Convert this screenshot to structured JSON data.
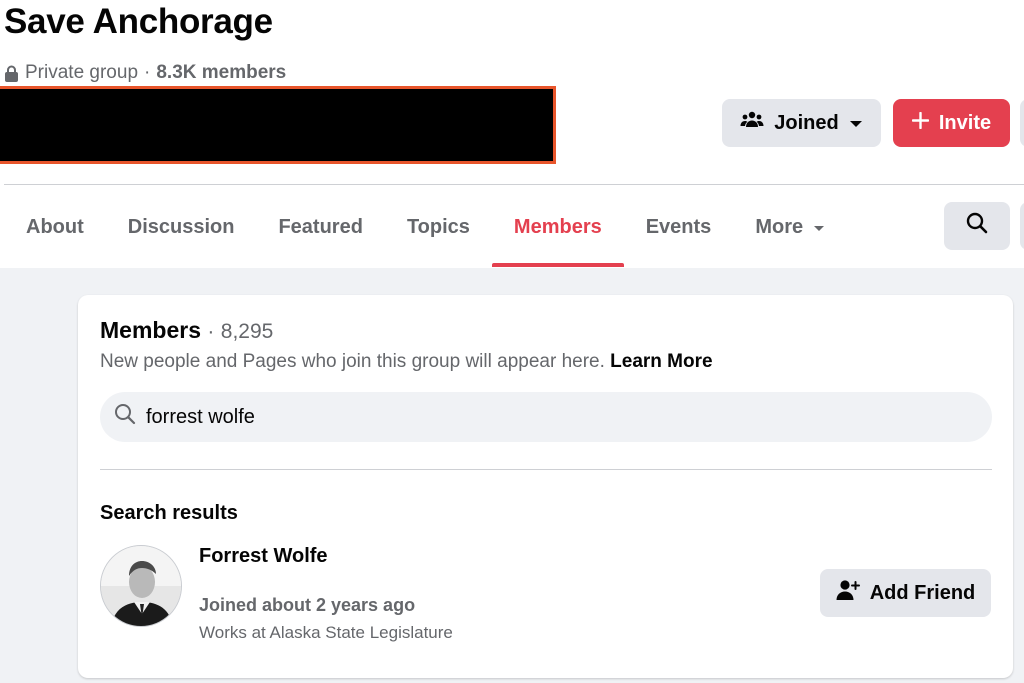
{
  "group": {
    "title": "Save Anchorage",
    "privacy": "Private group",
    "separator": "·",
    "members_short": "8.3K members"
  },
  "actions": {
    "joined_label": "Joined",
    "invite_label": "Invite"
  },
  "tabs": [
    {
      "label": "About"
    },
    {
      "label": "Discussion"
    },
    {
      "label": "Featured"
    },
    {
      "label": "Topics"
    },
    {
      "label": "Members"
    },
    {
      "label": "Events"
    },
    {
      "label": "More"
    }
  ],
  "members_card": {
    "title": "Members",
    "separator": "·",
    "count": "8,295",
    "description": "New people and Pages who join this group will appear here.",
    "learn_more": "Learn More",
    "search_value": "forrest wolfe",
    "results_label": "Search results",
    "result": {
      "name": "Forrest Wolfe",
      "joined": "Joined about 2 years ago",
      "work": "Works at Alaska State Legislature",
      "add_friend_label": "Add Friend"
    }
  },
  "colors": {
    "accent": "#e4404f",
    "button_bg": "#e4e6eb",
    "secondary_text": "#65676b"
  },
  "icons": [
    "lock-icon",
    "group-people-icon",
    "caret-down-icon",
    "plus-icon",
    "search-icon",
    "add-friend-icon"
  ]
}
